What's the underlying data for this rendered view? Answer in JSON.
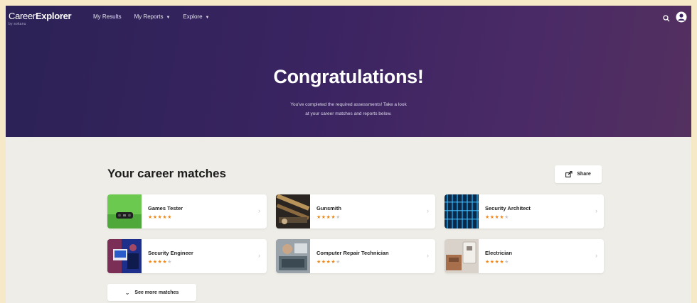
{
  "header": {
    "brand_prefix": "Career",
    "brand_suffix": "Explorer",
    "brand_tagline": "by sokanu",
    "nav": [
      {
        "label": "My Results",
        "has_dropdown": false
      },
      {
        "label": "My Reports",
        "has_dropdown": true
      },
      {
        "label": "Explore",
        "has_dropdown": true
      }
    ],
    "icons": {
      "search": "search-icon",
      "account": "user-account-icon"
    }
  },
  "hero": {
    "title": "Congratulations!",
    "subtitle_line1": "You've completed the required assessments! Take a look",
    "subtitle_line2": "at your career matches and reports below."
  },
  "matches": {
    "heading": "Your career matches",
    "share_label": "Share",
    "see_more_label": "See more matches",
    "cards": [
      {
        "name": "Games Tester",
        "rating": 5,
        "max": 5
      },
      {
        "name": "Gunsmith",
        "rating": 4,
        "max": 5
      },
      {
        "name": "Security Architect",
        "rating": 4,
        "max": 5
      },
      {
        "name": "Security Engineer",
        "rating": 4,
        "max": 5
      },
      {
        "name": "Computer Repair Technician",
        "rating": 4,
        "max": 5
      },
      {
        "name": "Electrician",
        "rating": 4,
        "max": 5
      }
    ]
  },
  "colors": {
    "hero_dark": "#2b2256",
    "hero_light": "#53305f",
    "star": "#f0881a",
    "page_bg": "#eeede7"
  }
}
